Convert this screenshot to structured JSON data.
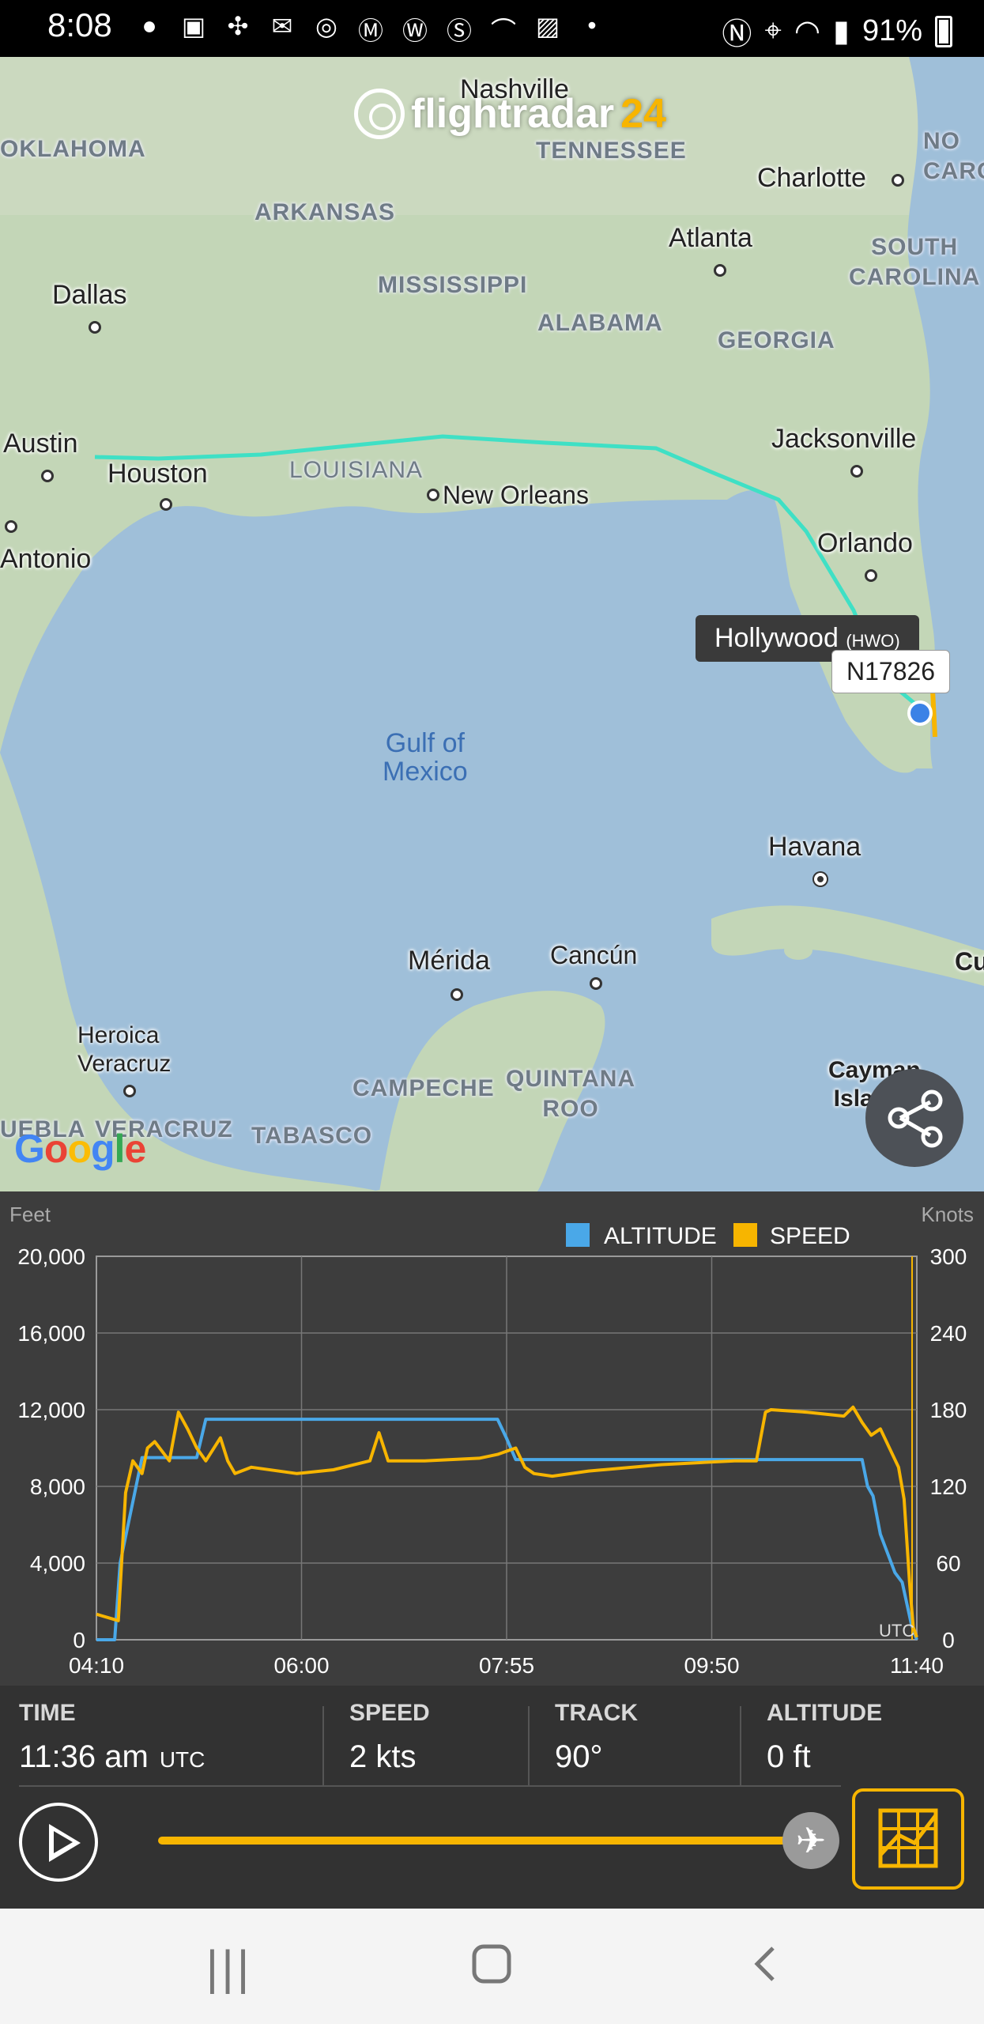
{
  "status_bar": {
    "time": "8:08",
    "battery": "91%",
    "icons": [
      "account-icon",
      "shopping-bag-icon",
      "slack-icon",
      "gmail-icon",
      "podcast-icon",
      "medium-icon",
      "washington-post-icon",
      "s-icon",
      "amazon-icon",
      "gallery-icon",
      "dot-icon"
    ],
    "right_icons": [
      "nfc-icon",
      "location-icon",
      "wifi-icon",
      "signal-icon",
      "battery-icon"
    ]
  },
  "map": {
    "logo_text": "flightradar",
    "logo_num": "24",
    "cities": [
      {
        "name": "Nashville",
        "key": "nashville"
      },
      {
        "name": "Charlotte",
        "key": "charlotte"
      },
      {
        "name": "Atlanta",
        "key": "atlanta"
      },
      {
        "name": "Dallas",
        "key": "dallas"
      },
      {
        "name": "Austin",
        "key": "austin"
      },
      {
        "name": "Houston",
        "key": "houston"
      },
      {
        "name": "New Orleans",
        "key": "new-orleans"
      },
      {
        "name": "Jacksonville",
        "key": "jacksonville"
      },
      {
        "name": "Orlando",
        "key": "orlando"
      },
      {
        "name": "Antonio",
        "key": "san-antonio"
      },
      {
        "name": "Havana",
        "key": "havana"
      },
      {
        "name": "Mérida",
        "key": "merida"
      },
      {
        "name": "Cancún",
        "key": "cancun"
      },
      {
        "name": "Heroica\nVeracruz",
        "key": "veracruz"
      },
      {
        "name": "Cayman\nIslands",
        "key": "cayman"
      },
      {
        "name": "Cu",
        "key": "cuba"
      }
    ],
    "states": [
      {
        "name": "OKLAHOMA",
        "key": "oklahoma"
      },
      {
        "name": "TENNESSEE",
        "key": "tennessee"
      },
      {
        "name": "ARKANSAS",
        "key": "arkansas"
      },
      {
        "name": "MISSISSIPPI",
        "key": "mississippi"
      },
      {
        "name": "ALABAMA",
        "key": "alabama"
      },
      {
        "name": "GEORGIA",
        "key": "georgia"
      },
      {
        "name": "SOUTH\nCAROLINA",
        "key": "south-carolina"
      },
      {
        "name": "NO\nCARO",
        "key": "north-carolina"
      },
      {
        "name": "LOUISIANA",
        "key": "louisiana"
      },
      {
        "name": "CAMPECHE",
        "key": "campeche"
      },
      {
        "name": "QUINTANA\nROO",
        "key": "quintana-roo"
      },
      {
        "name": "TABASCO",
        "key": "tabasco"
      },
      {
        "name": "UEBLA",
        "key": "puebla"
      },
      {
        "name": "VERACRUZ",
        "key": "veracruz-state"
      }
    ],
    "water": "Gulf of\nMexico",
    "airport_tooltip": "Hollywood",
    "airport_code": "(HWO)",
    "registration": "N17826",
    "attribution": "Google",
    "flight_path_color": "#3fe0c5"
  },
  "chart_data": {
    "type": "line",
    "legend": [
      "ALTITUDE",
      "SPEED"
    ],
    "left_axis_label": "Feet",
    "right_axis_label": "Knots",
    "utc_label": "UTC",
    "x_ticks": [
      "04:10",
      "06:00",
      "07:55",
      "09:50",
      "11:40"
    ],
    "y_left_ticks": [
      "20,000",
      "16,000",
      "12,000",
      "8,000",
      "4,000",
      "0"
    ],
    "y_right_ticks": [
      "300",
      "240",
      "180",
      "120",
      "60",
      "0"
    ],
    "ylim_left": [
      0,
      20000
    ],
    "ylim_right": [
      0,
      300
    ],
    "x_range_minutes": [
      250,
      700
    ],
    "series": [
      {
        "name": "ALTITUDE",
        "color": "#4aa8e8",
        "axis": "left",
        "x": [
          250,
          260,
          263,
          275,
          286,
          305,
          310,
          320,
          400,
          450,
          470,
          475,
          480,
          490,
          500,
          520,
          540,
          580,
          600,
          620,
          650,
          670,
          673,
          676,
          680,
          688,
          692,
          697,
          700
        ],
        "y": [
          0,
          0,
          4000,
          9500,
          9500,
          9500,
          11500,
          11500,
          11500,
          11500,
          11500,
          10500,
          9400,
          9400,
          9400,
          9400,
          9400,
          9400,
          9400,
          9400,
          9400,
          9400,
          8000,
          7500,
          5500,
          3500,
          3000,
          800,
          0
        ]
      },
      {
        "name": "SPEED",
        "color": "#f7b500",
        "axis": "right",
        "x": [
          250,
          262,
          266,
          270,
          275,
          278,
          282,
          290,
          295,
          300,
          305,
          310,
          318,
          322,
          326,
          335,
          360,
          380,
          400,
          405,
          410,
          430,
          460,
          470,
          480,
          485,
          490,
          500,
          520,
          560,
          600,
          612,
          617,
          620,
          640,
          660,
          665,
          670,
          675,
          680,
          690,
          693,
          696,
          698,
          700
        ],
        "y": [
          20,
          15,
          115,
          140,
          130,
          150,
          155,
          140,
          178,
          165,
          150,
          140,
          158,
          140,
          130,
          135,
          130,
          133,
          140,
          162,
          140,
          140,
          142,
          145,
          150,
          135,
          130,
          128,
          132,
          137,
          140,
          140,
          178,
          180,
          178,
          175,
          182,
          170,
          160,
          165,
          135,
          110,
          45,
          10,
          2
        ]
      }
    ]
  },
  "info": {
    "time_label": "TIME",
    "time_value": "11:36 am",
    "time_unit": "UTC",
    "speed_label": "SPEED",
    "speed_value": "2 kts",
    "track_label": "TRACK",
    "track_value": "90°",
    "altitude_label": "ALTITUDE",
    "altitude_value": "0 ft",
    "progress": 1.0
  },
  "nav": {
    "recents": "|||",
    "home": "○",
    "back": "‹"
  }
}
